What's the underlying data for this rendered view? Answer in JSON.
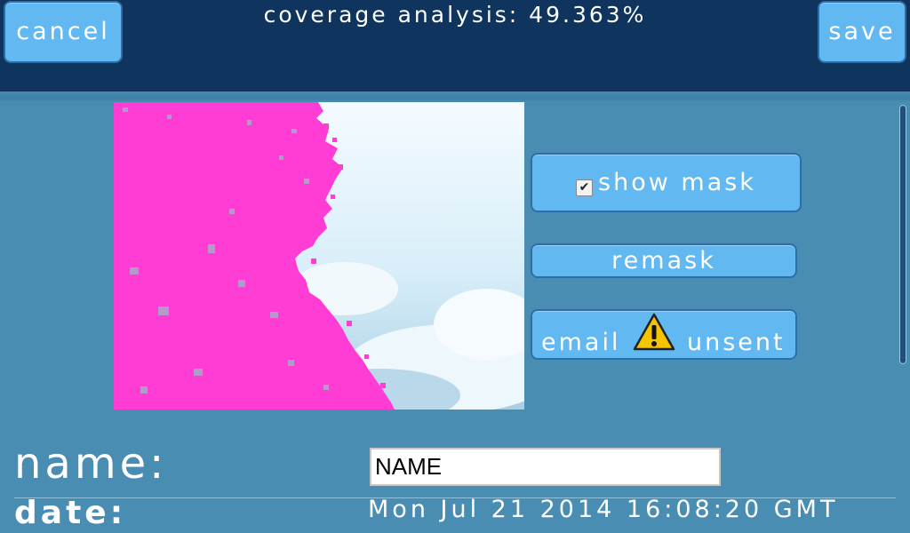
{
  "header": {
    "title": "coverage analysis: 49.363%",
    "cancel_label": "cancel",
    "save_label": "save",
    "background_color": "#0f355f"
  },
  "preview": {
    "mask_color": "#ff3dd4",
    "coverage_percent": 49.363
  },
  "actions": {
    "show_mask_label": "show mask",
    "show_mask_checked": true,
    "remask_label": "remask",
    "email_label": "email",
    "email_status_label": "unsent",
    "email_status_icon": "warning-icon"
  },
  "form": {
    "name_label": "name:",
    "name_value": "NAME",
    "date_label": "date:",
    "date_value": "Mon Jul 21 2014 16:08:20 GMT"
  },
  "colors": {
    "button": "#62b8f0",
    "page_background": "#4a8db3",
    "warning": "#f5c400"
  }
}
